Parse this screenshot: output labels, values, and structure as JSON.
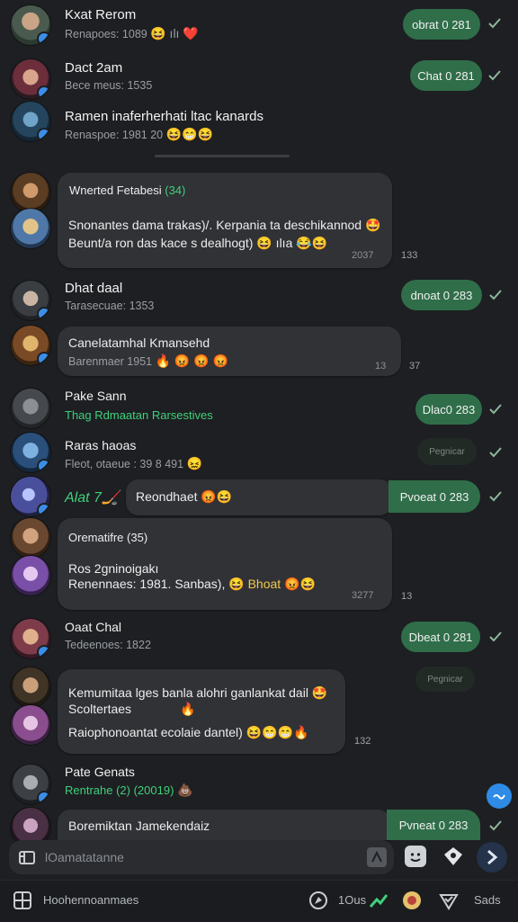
{
  "conversations": [
    {
      "name": "Kxat Rerom",
      "sub": "Renapoes: 1089",
      "sub_emojis": "😆 ılı ❤️",
      "pill": "obrat 0 281"
    },
    {
      "name": "Dact 2am",
      "sub": "Bece meus: 1535",
      "pill": "Chat 0 281"
    },
    {
      "name": "Ramen inaferherhati ltac kanards",
      "sub": "Renaspoe: 1981  20",
      "sub_emojis": "😆😁😆"
    }
  ],
  "group_message_1": {
    "sender": "Wnerted Fetabesi",
    "sender_tag": "(34)",
    "line1": "Snonantes dama trakas)/. Kerpania ta deschikannod",
    "line1_emoji": "🤩",
    "line2": "Beunt/a ron das kace s dealhogt)",
    "line2_emojis": "😆 ılıa 😂😆",
    "time": "2037",
    "side": "133"
  },
  "conversation_4": {
    "name": "Dhat daal",
    "sub": "Tarasecuae: 1353",
    "pill": "dnoat 0 283"
  },
  "message_5": {
    "text": "Canelatamhal Kmansehd",
    "sub": "Barenmaer 1951",
    "sub_emojis": "🔥 😡 😡 😡",
    "time": "13",
    "side": "37"
  },
  "conversation_6": {
    "name": "Pake Sann",
    "sub": "Thag Rdmaatan Rarsestives",
    "pill": "Dlac0 283"
  },
  "conversation_7": {
    "name": "Raras haoas",
    "sub": "Fleot, otaeue : 39 8 491",
    "sub_emojis": "😖",
    "pill": "Pegnicar"
  },
  "message_8": {
    "sender": "Alat",
    "sender_tag": "7🏒",
    "text": "Reondhaet",
    "emojis": "😡😆",
    "pill": "Pvoeat 0 283"
  },
  "group_message_2": {
    "sender": "Orematifre",
    "sender_tag": "(35)",
    "line1": "Ros 2gninoigakı",
    "line2": "Renennaes: 1981. Sanbas),",
    "line2_emojis": "😆 Bhoat 😡😆",
    "time": "3277",
    "side": "13"
  },
  "conversation_9": {
    "name": "Oaat Chal",
    "sub": "Tedeenoes: 1822",
    "pill": "Dbeat 0 281"
  },
  "group_message_3": {
    "line1": "Kemumitaa lges banla alohri ganlankat dail",
    "line1_emoji": "🤩",
    "line2": "Scoltertaes",
    "line2_emoji": "🔥",
    "line3": "Raiophonoantat ecolaie dantel)",
    "line3_emojis": "😆😁😁🔥",
    "side": "132",
    "pill": "Pegnicar"
  },
  "conversation_10": {
    "name": "Pate Genats",
    "sub": "Rentrahe (2) (20019)",
    "sub_emoji": "💩"
  },
  "message_11": {
    "text": "Boremiktan Jamekendaiz",
    "pill": "Pvneat 0 283"
  },
  "input": {
    "placeholder": "lOamatatanne"
  },
  "bottom_bar": {
    "label": "Hoohennoanmaes",
    "item1": "1Ous",
    "item2": "Sads"
  },
  "colors": {
    "background": "#1d1f22",
    "bubble": "#303236",
    "pill": "#2f6e49",
    "accent_green": "#3fd07b",
    "accent_blue": "#2e8be6"
  }
}
